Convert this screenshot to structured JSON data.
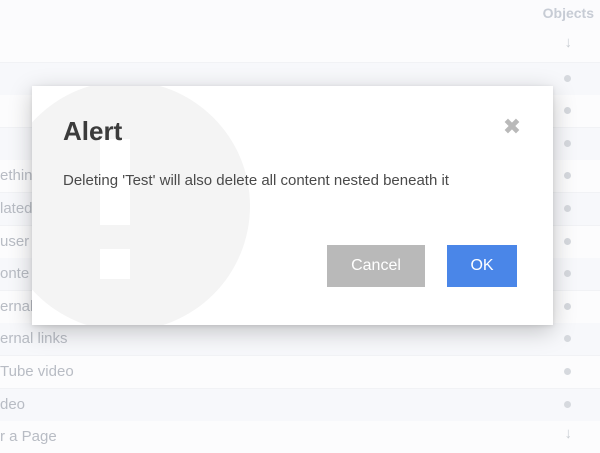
{
  "background": {
    "header_label": "Objects",
    "rows": [
      {
        "label": "",
        "marker": "arrow"
      },
      {
        "label": "",
        "marker": "dot"
      },
      {
        "label": "",
        "marker": "dot"
      },
      {
        "label": "",
        "marker": "dot"
      },
      {
        "label": "ethin",
        "marker": "dot"
      },
      {
        "label": "lated",
        "marker": "dot"
      },
      {
        "label": "user",
        "marker": "dot"
      },
      {
        "label": "onte",
        "marker": "dot"
      },
      {
        "label": "ernal",
        "marker": "dot"
      },
      {
        "label": "ernal links",
        "marker": "dot"
      },
      {
        "label": "Tube video",
        "marker": "dot"
      },
      {
        "label": "deo",
        "marker": "dot"
      },
      {
        "label": "r a Page",
        "marker": "arrow"
      }
    ]
  },
  "dialog": {
    "title": "Alert",
    "message": "Deleting 'Test' will also delete all content nested beneath it",
    "cancel_label": "Cancel",
    "ok_label": "OK"
  },
  "colors": {
    "ok_button": "#4a86e8",
    "cancel_button": "#b9b9b9"
  },
  "icons": {
    "close": "close-icon",
    "watermark": "exclamation-icon",
    "row_dot": "dot-icon",
    "row_arrow": "arrow-down-icon"
  }
}
